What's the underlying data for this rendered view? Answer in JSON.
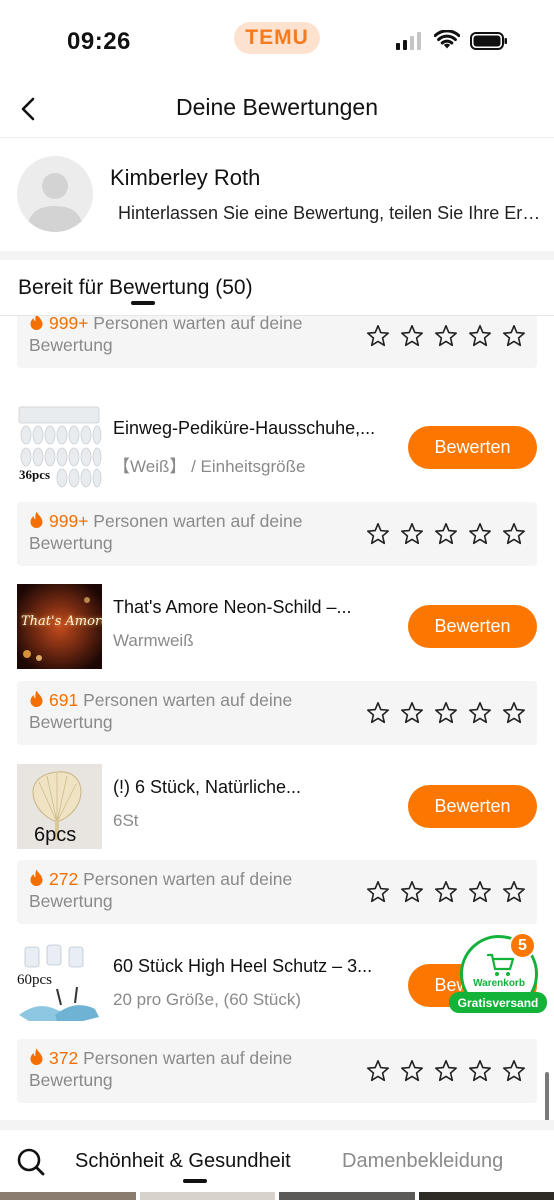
{
  "status_bar": {
    "time": "09:26",
    "brand": "TEMU"
  },
  "header": {
    "title": "Deine Bewertungen"
  },
  "profile": {
    "name": "Kimberley Roth",
    "subtitle": "Hinterlassen Sie eine Bewertung, teilen Sie Ihre Erfahrungen"
  },
  "section": {
    "label": "Bereit für Bewertung (50)"
  },
  "waiting_suffix": "Personen warten auf deine Bewertung",
  "top_waiting": {
    "count": "999+"
  },
  "products": [
    {
      "name": "Einweg-Pediküre-Hausschuhe,...",
      "variant": "【Weiß】 / Einheitsgröße",
      "button": "Bewerten",
      "thumb_caption": "36pcs",
      "waiting_count": "999+",
      "thumb_icon": "slippers-image"
    },
    {
      "name": "That's Amore Neon-Schild –...",
      "variant": "Warmweiß",
      "button": "Bewerten",
      "thumb_caption": "That's Amore",
      "waiting_count": "691",
      "thumb_icon": "neon-sign-image"
    },
    {
      "name": "(!) 6 Stück, Natürliche...",
      "variant": "6St",
      "button": "Bewerten",
      "thumb_caption": "6pcs",
      "waiting_count": "272",
      "thumb_icon": "woven-fan-image"
    },
    {
      "name": "60 Stück High Heel Schutz – 3...",
      "variant": "20 pro Größe, (60 Stück)",
      "button": "Bewerten",
      "thumb_caption": "60pcs",
      "waiting_count": "372",
      "thumb_icon": "heel-protector-image"
    }
  ],
  "cart": {
    "badge": "5",
    "label": "Warenkorb",
    "free_shipping": "Gratisversand"
  },
  "bottom_nav": {
    "active": "Schönheit & Gesundheit",
    "inactive": "Damenbekleidung"
  },
  "colors": {
    "accent": "#fb7701",
    "green": "#13b33a",
    "muted": "#8a8a8a"
  }
}
